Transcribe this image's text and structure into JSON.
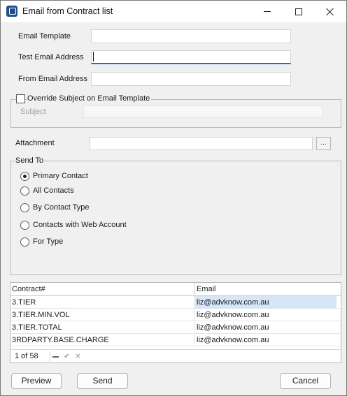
{
  "window": {
    "title": "Email from Contract list"
  },
  "fields": {
    "email_template": {
      "label": "Email Template",
      "value": ""
    },
    "test_email": {
      "label": "Test Email Address",
      "value": ""
    },
    "from_email": {
      "label": "From Email Address",
      "value": ""
    }
  },
  "override": {
    "label": "Override Subject on Email Template",
    "checked": false,
    "subject_label": "Subject",
    "subject_value": ""
  },
  "attachment": {
    "label": "Attachment",
    "value": "",
    "browse_label": "..."
  },
  "send_to": {
    "legend": "Send To",
    "options": [
      {
        "label": "Primary Contact",
        "checked": true
      },
      {
        "label": "All Contacts",
        "checked": false
      },
      {
        "label": "By Contact Type",
        "checked": false
      },
      {
        "label": "Contacts with Web Account",
        "checked": false
      },
      {
        "label": "For Type",
        "checked": false
      }
    ]
  },
  "grid": {
    "columns": [
      "Contract#",
      "Email"
    ],
    "rows": [
      [
        "3.TIER",
        "liz@advknow.com.au"
      ],
      [
        "3.TIER.MIN.VOL",
        "liz@advknow.com.au"
      ],
      [
        "3.TIER.TOTAL",
        "liz@advknow.com.au"
      ],
      [
        "3RDPARTY.BASE.CHARGE",
        "liz@advknow.com.au"
      ]
    ],
    "pager": "1 of 58"
  },
  "buttons": {
    "preview": "Preview",
    "send": "Send",
    "cancel": "Cancel"
  }
}
